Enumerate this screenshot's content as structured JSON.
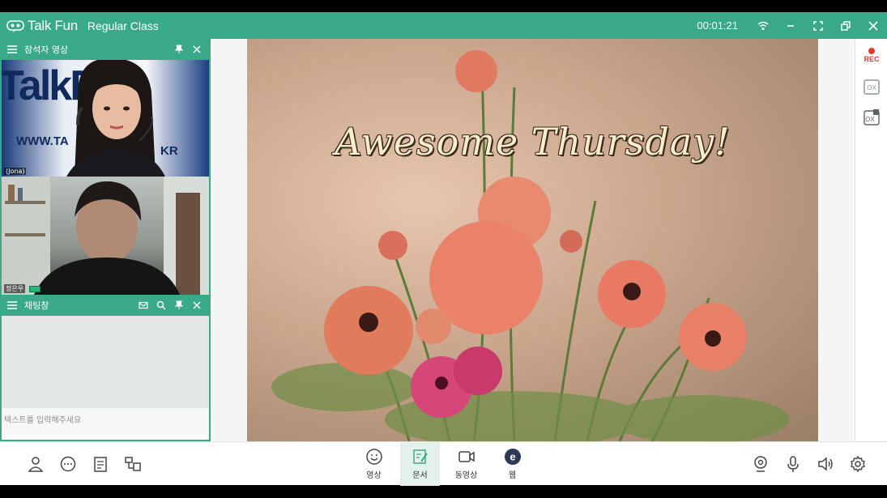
{
  "app": {
    "logo_text": "Talk Fun",
    "class_name": "Regular Class",
    "timer": "00:01:21"
  },
  "colors": {
    "accent": "#3aa98a",
    "rec": "#e23b2e",
    "active_tab_bg": "#e3f1ec"
  },
  "video_panel": {
    "title": "참석자 영상",
    "participants": [
      {
        "name_tag": "(Jona)",
        "wordmark": "TalkFun",
        "sign_text": "WWW.TA",
        "sign_text_2": "KR"
      },
      {
        "name_tag": "정은우"
      }
    ]
  },
  "chat_panel": {
    "title": "채팅창",
    "placeholder": "텍스트를 입력해주세요"
  },
  "slide": {
    "title": "Awesome Thursday!"
  },
  "right_tools": {
    "rec_label": "REC",
    "ox_label": "OX",
    "ox2_label": "OX"
  },
  "bottom_tabs": [
    {
      "label": "영상",
      "icon": "smiley-icon"
    },
    {
      "label": "문서",
      "icon": "document-icon",
      "active": true
    },
    {
      "label": "동영상",
      "icon": "video-camera-icon"
    },
    {
      "label": "웹",
      "icon": "web-e-icon"
    }
  ]
}
